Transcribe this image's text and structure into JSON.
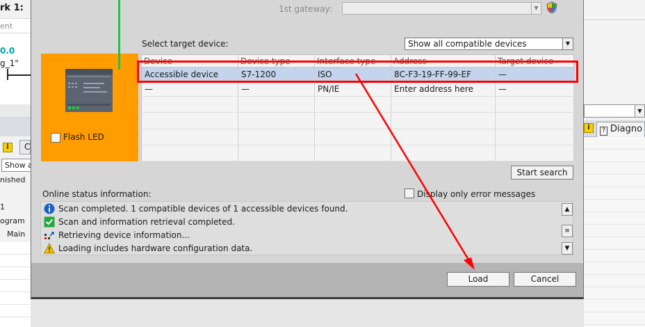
{
  "background": {
    "network_title": "rk 1:",
    "comment_fragment": "ent",
    "address_fragment": "0.0",
    "tag_fragment": "g_1\"",
    "info_tab_fragment": "C",
    "show_all_fragment": "Show a",
    "finished_fragment": "nished",
    "row1_fragment": "1",
    "row2_fragment": "ogram",
    "row3_fragment": "Main",
    "diagnostics_tab_fragment": "Diagno"
  },
  "dialog": {
    "gateway_label": "1st gateway:",
    "select_target_label": "Select target device:",
    "show_devices_dropdown": "Show all compatible devices",
    "flash_led_label": "Flash LED",
    "table": {
      "columns": [
        "Device",
        "Device type",
        "Interface type",
        "Address",
        "Target device"
      ],
      "rows": [
        [
          "Accessible device",
          "S7-1200",
          "ISO",
          "8C-F3-19-FF-99-EF",
          "—"
        ],
        [
          "—",
          "—",
          "PN/IE",
          "Enter address here",
          "—"
        ]
      ]
    },
    "start_search_button": "Start search",
    "online_status_label": "Online status information:",
    "only_errors_label": "Display only error messages",
    "messages": [
      {
        "icon": "info-icon",
        "text": "Scan completed. 1 compatible devices of 1 accessible devices found."
      },
      {
        "icon": "check-icon",
        "text": "Scan and information retrieval completed."
      },
      {
        "icon": "retrieving-icon",
        "text": "Retrieving device information..."
      },
      {
        "icon": "warning-icon",
        "text": "Loading includes hardware configuration data."
      }
    ],
    "load_button": "Load",
    "cancel_button": "Cancel"
  },
  "colors": {
    "device_panel": "#ff9c00",
    "selected_row": "#c3d4ec",
    "annotation": "#ff0000",
    "connection_line": "#22c24a"
  }
}
